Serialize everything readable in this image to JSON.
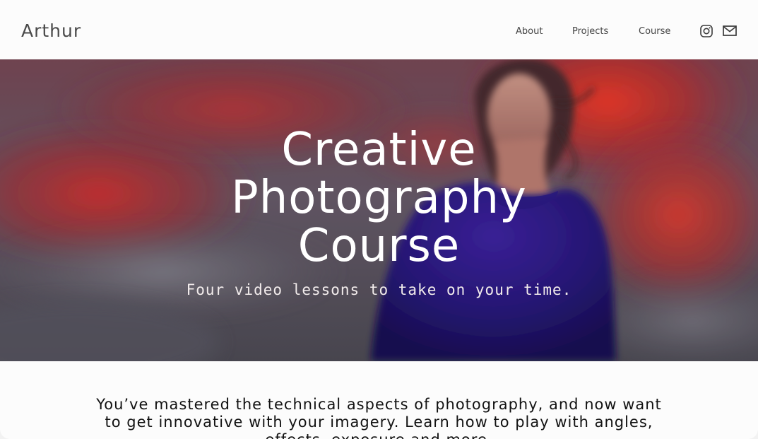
{
  "header": {
    "logo": "Arthur",
    "nav": [
      {
        "label": "About"
      },
      {
        "label": "Projects"
      },
      {
        "label": "Course"
      }
    ],
    "social": [
      {
        "icon": "instagram-icon"
      },
      {
        "icon": "mail-icon"
      }
    ]
  },
  "hero": {
    "title_lines": [
      "Creative",
      "Photography",
      "Course"
    ],
    "subtitle": "Four video lessons to take on your time."
  },
  "intro": {
    "lines": [
      "You’ve mastered the technical aspects of photography, and now want",
      "to get innovative with your imagery. Learn how to play with angles,",
      "effects, exposure and more."
    ]
  },
  "colors": {
    "sky_red": "#c8282a",
    "sweater_blue": "#26157a",
    "cloud_gray": "#6d6a78",
    "text_dark": "#121212"
  }
}
